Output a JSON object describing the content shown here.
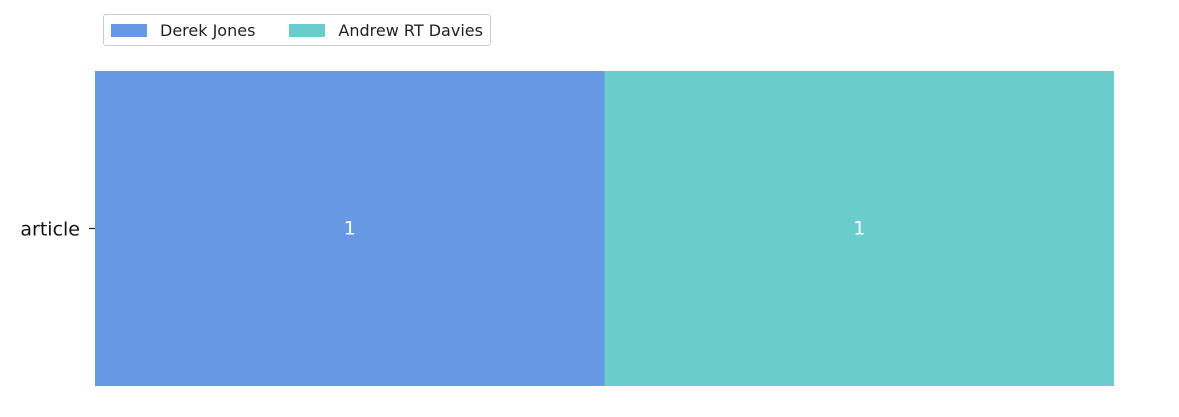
{
  "chart_data": {
    "type": "bar",
    "orientation": "horizontal",
    "stacked": true,
    "categories": [
      "article"
    ],
    "series": [
      {
        "name": "Derek Jones",
        "values": [
          1
        ],
        "color": "#6699e3"
      },
      {
        "name": "Andrew RT Davies",
        "values": [
          1
        ],
        "color": "#68cdcc"
      }
    ],
    "data_labels": true,
    "xlim": [
      0,
      2
    ],
    "legend_position": "top-left",
    "grid": false,
    "x_axis_visible": false,
    "title": "",
    "xlabel": "",
    "ylabel": ""
  }
}
